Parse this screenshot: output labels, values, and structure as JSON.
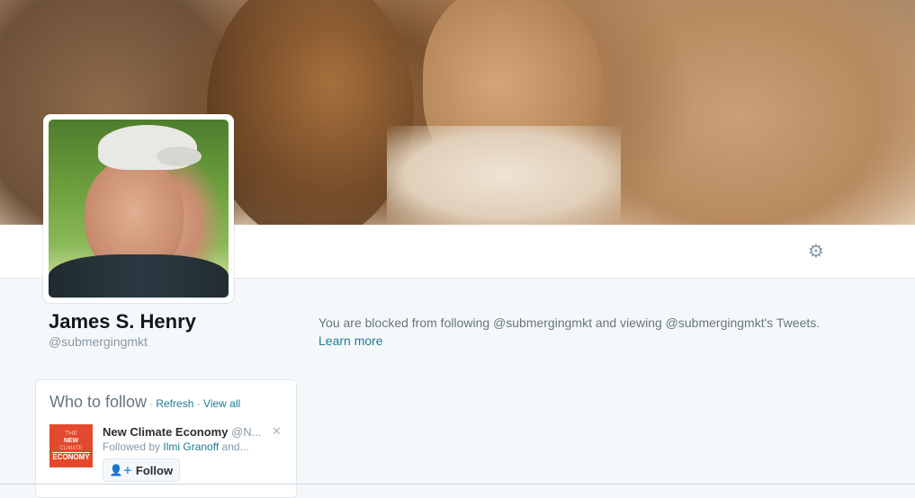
{
  "profile": {
    "name": "James S. Henry",
    "handle": "@submergingmkt"
  },
  "blocked": {
    "message": "You are blocked from following @submergingmkt and viewing @submergingmkt's Tweets.",
    "learn_more": "Learn more"
  },
  "navbar": {
    "settings_icon": "gear-icon"
  },
  "who_to_follow": {
    "title": "Who to follow",
    "separator": " · ",
    "refresh": "Refresh",
    "view_all": "View all",
    "suggestion": {
      "logo_lines": [
        "THE",
        "NEW",
        "CLIMATE",
        "ECONOMY"
      ],
      "name": "New Climate Economy",
      "handle": "@N...",
      "followed_prefix": "Followed by ",
      "followed_by": "Ilmi Granoff",
      "followed_suffix": " and...",
      "close_icon": "close-icon",
      "follow_label": "Follow"
    }
  },
  "colors": {
    "link": "#1b7d93",
    "muted": "#8899a6",
    "logo_bg": "#e3492c"
  }
}
